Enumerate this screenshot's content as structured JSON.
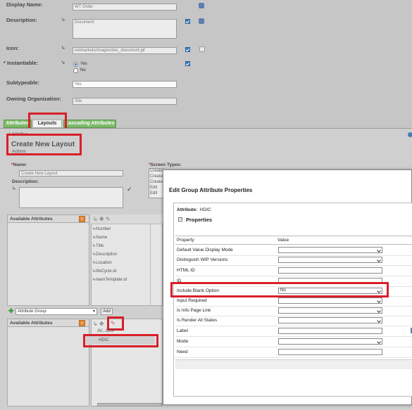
{
  "form": {
    "display_name": {
      "label": "Display Name:",
      "value": "WT Order"
    },
    "description": {
      "label": "Description:",
      "value": "Document"
    },
    "icon": {
      "label": "Icon:",
      "value": "netmarkets/images/doc_document.gif"
    },
    "instantiable": {
      "label": "Instantiable:",
      "required_mark": "*",
      "yes": "Yes",
      "no": "No"
    },
    "subtypeable": {
      "label": "Subtypeable:",
      "value": "Yes"
    },
    "owning_org": {
      "label": "Owning Organization:",
      "value": "Site"
    }
  },
  "tabs": [
    {
      "label": "Attributes"
    },
    {
      "label": "Layouts"
    },
    {
      "label": "Cascading Attributes"
    }
  ],
  "layouts": {
    "breadcrumb": "Layouts",
    "title": "Create New Layout",
    "actions": "Actions",
    "name_label": "Name:",
    "name_value": "Create New Layout",
    "description_label": "Description:",
    "screen_types_label": "Screen Types:",
    "screen_types": [
      "Create",
      "Create",
      "Create",
      "Edit",
      "Edit"
    ],
    "available_attributes": "Available Attributes",
    "attribute_list": [
      "Number",
      "Name",
      "Title",
      "Description",
      "Location",
      "lifeCycle.id",
      "teamTemplate.id"
    ],
    "attribute_group_select": "Attribute Group",
    "add_button": "Add",
    "group_title": "AV...OUP",
    "group_item": "HDIC"
  },
  "dialog": {
    "title": "Edit Group Attribute Properties",
    "attribute_label": "Attribute:",
    "attribute_value": "HDIC",
    "section": "Properties",
    "col_property": "Property",
    "col_value": "Value",
    "properties": [
      {
        "name": "Default Value Display Mode",
        "kind": "select",
        "value": ""
      },
      {
        "name": "Distinguish WIP Versions",
        "kind": "select",
        "value": ""
      },
      {
        "name": "HTML ID",
        "kind": "text",
        "value": ""
      },
      {
        "name": "ID",
        "kind": "text",
        "value": ""
      },
      {
        "name": "Include Blank Option",
        "kind": "select",
        "value": "No"
      },
      {
        "name": "Input Required",
        "kind": "select",
        "value": ""
      },
      {
        "name": "Is Info Page Link",
        "kind": "select",
        "value": ""
      },
      {
        "name": "Is Render All States",
        "kind": "select",
        "value": ""
      },
      {
        "name": "Label",
        "kind": "text",
        "value": ""
      },
      {
        "name": "Mode",
        "kind": "select",
        "value": ""
      },
      {
        "name": "Need",
        "kind": "text",
        "value": ""
      }
    ]
  },
  "colors": {
    "highlight": "#d81f2a",
    "tab_green": "#7db96a",
    "checkbox_blue": "#3b7fc4",
    "collapse_orange": "#e08a3a"
  }
}
